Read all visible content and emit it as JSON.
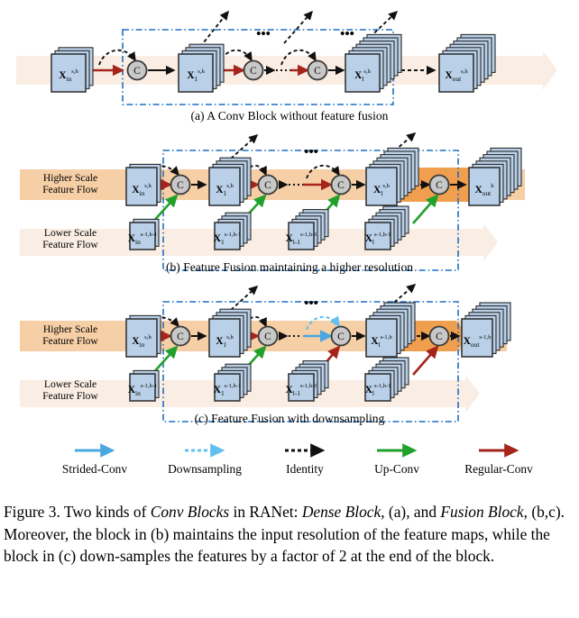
{
  "figure": {
    "number": "Figure 3.",
    "caption_runs": [
      {
        "t": "Figure 3. Two kinds of ",
        "i": false
      },
      {
        "t": "Conv Blocks",
        "i": true
      },
      {
        "t": " in RANet: ",
        "i": false
      },
      {
        "t": "Dense Block",
        "i": true
      },
      {
        "t": ", (a), and ",
        "i": false
      },
      {
        "t": "Fusion Block",
        "i": true
      },
      {
        "t": ", (b,c). Moreover, the block in (b) maintains the input resolution of the feature maps, while the block in (c) down-samples the features by a factor of 2 at the end of the block.",
        "i": false
      }
    ],
    "caption_plain": "Figure 3. Two kinds of Conv Blocks in RANet: Dense Block, (a), and Fusion Block, (b,c). Moreover, the block in (b) maintains the input resolution of the feature maps, while the block in (c) down-samples the features by a factor of 2 at the end of the block."
  },
  "colors": {
    "box_fill": "#b9d0e8",
    "box_stroke": "#2b2b2b",
    "band_light": "#faeee4",
    "band_medium": "#f6cfa6",
    "band_strong": "#ef9f4e",
    "node_fill": "#c8c8c8",
    "node_stroke": "#3a3a3a",
    "dashed_border": "#1f6fc4",
    "strided_conv": "#4aa8e0",
    "downsampling": "#62c0ef",
    "identity": "#111111",
    "up_conv": "#22a02c",
    "regular_conv": "#a5241c",
    "background": "#ffffff"
  },
  "panels": [
    {
      "id": "a",
      "caption": "(a) A Conv Block without feature fusion",
      "flow_rows": [],
      "upper_boxes": [
        {
          "name": "x-in",
          "base": "X",
          "sub": "in",
          "sup": "s,h",
          "stack": 3
        },
        {
          "name": "x-1",
          "base": "X",
          "sub": "1",
          "sup": "s,h",
          "stack": 4
        },
        {
          "name": "x-l",
          "base": "X",
          "sub": "l",
          "sup": "s,h",
          "stack": 7
        },
        {
          "name": "x-out",
          "base": "X",
          "sub": "out",
          "sup": "s,h",
          "stack": 7
        }
      ],
      "concat_nodes": [
        "C",
        "C",
        "C"
      ],
      "ellipsis": [
        "•••",
        "•••"
      ]
    },
    {
      "id": "b",
      "caption": "(b) Feature Fusion maintaining a higher resolution",
      "flow_rows": [
        {
          "name": "higher-scale-flow",
          "line1": "Higher Scale",
          "line2": "Feature Flow"
        },
        {
          "name": "lower-scale-flow",
          "line1": "Lower Scale",
          "line2": "Feature Flow"
        }
      ],
      "upper_boxes": [
        {
          "name": "x-in",
          "base": "X",
          "sub": "in",
          "sup": "s,h",
          "stack": 2
        },
        {
          "name": "x-1",
          "base": "X",
          "sub": "1",
          "sup": "s,h",
          "stack": 4
        },
        {
          "name": "x-l",
          "base": "X",
          "sub": "l",
          "sup": "s,h",
          "stack": 7
        },
        {
          "name": "x-out",
          "base": "X",
          "sub": "out",
          "sup": "h",
          "stack": 7
        }
      ],
      "lower_boxes": [
        {
          "name": "x-in-lower",
          "base": "X",
          "sub": "in",
          "sup": "s-1,h-1",
          "stack": 2
        },
        {
          "name": "x-1-lower",
          "base": "X",
          "sub": "1",
          "sup": "s-1,h-1",
          "stack": 4
        },
        {
          "name": "x-lminus1-lower",
          "base": "X",
          "sub": "l-1",
          "sup": "s-1,h-1",
          "stack": 5
        },
        {
          "name": "x-l-lower",
          "base": "X",
          "sub": "l",
          "sup": "s-1,h-1",
          "stack": 6
        }
      ],
      "concat_nodes": [
        "C",
        "C",
        "C",
        "C"
      ],
      "ellipsis": [
        "•••"
      ]
    },
    {
      "id": "c",
      "caption": "(c) Feature Fusion with downsampling",
      "flow_rows": [
        {
          "name": "higher-scale-flow",
          "line1": "Higher Scale",
          "line2": "Feature Flow"
        },
        {
          "name": "lower-scale-flow",
          "line1": "Lower Scale",
          "line2": "Feature Flow"
        }
      ],
      "upper_boxes": [
        {
          "name": "x-in",
          "base": "X",
          "sub": "in",
          "sup": "s,h",
          "stack": 2
        },
        {
          "name": "x-1",
          "base": "X",
          "sub": "1",
          "sup": "s,h",
          "stack": 4
        },
        {
          "name": "x-l",
          "base": "X",
          "sub": "l",
          "sup": "s-1,h",
          "stack": 6
        },
        {
          "name": "x-out",
          "base": "X",
          "sub": "out",
          "sup": "s-1,h",
          "stack": 6
        }
      ],
      "lower_boxes": [
        {
          "name": "x-in-lower",
          "base": "X",
          "sub": "in",
          "sup": "s-1,h-1",
          "stack": 2
        },
        {
          "name": "x-1-lower",
          "base": "X",
          "sub": "1",
          "sup": "s-1,h-1",
          "stack": 4
        },
        {
          "name": "x-lminus1-lower",
          "base": "X",
          "sub": "l-1",
          "sup": "s-1,h-1",
          "stack": 5
        },
        {
          "name": "x-l-lower",
          "base": "X",
          "sub": "l",
          "sup": "s-1,h-1",
          "stack": 6
        }
      ],
      "concat_nodes": [
        "C",
        "C",
        "C",
        "C"
      ],
      "ellipsis": [
        "•••"
      ]
    }
  ],
  "legend": {
    "items": [
      {
        "name": "strided-conv",
        "label": "Strided-Conv",
        "color": "#4aa8e0",
        "style": "solid"
      },
      {
        "name": "downsampling",
        "label": "Downsampling",
        "color": "#62c0ef",
        "style": "dashed"
      },
      {
        "name": "identity",
        "label": "Identity",
        "color": "#111111",
        "style": "dashed"
      },
      {
        "name": "up-conv",
        "label": "Up-Conv",
        "color": "#22a02c",
        "style": "solid"
      },
      {
        "name": "regular-conv",
        "label": "Regular-Conv",
        "color": "#a5241c",
        "style": "solid"
      }
    ]
  }
}
